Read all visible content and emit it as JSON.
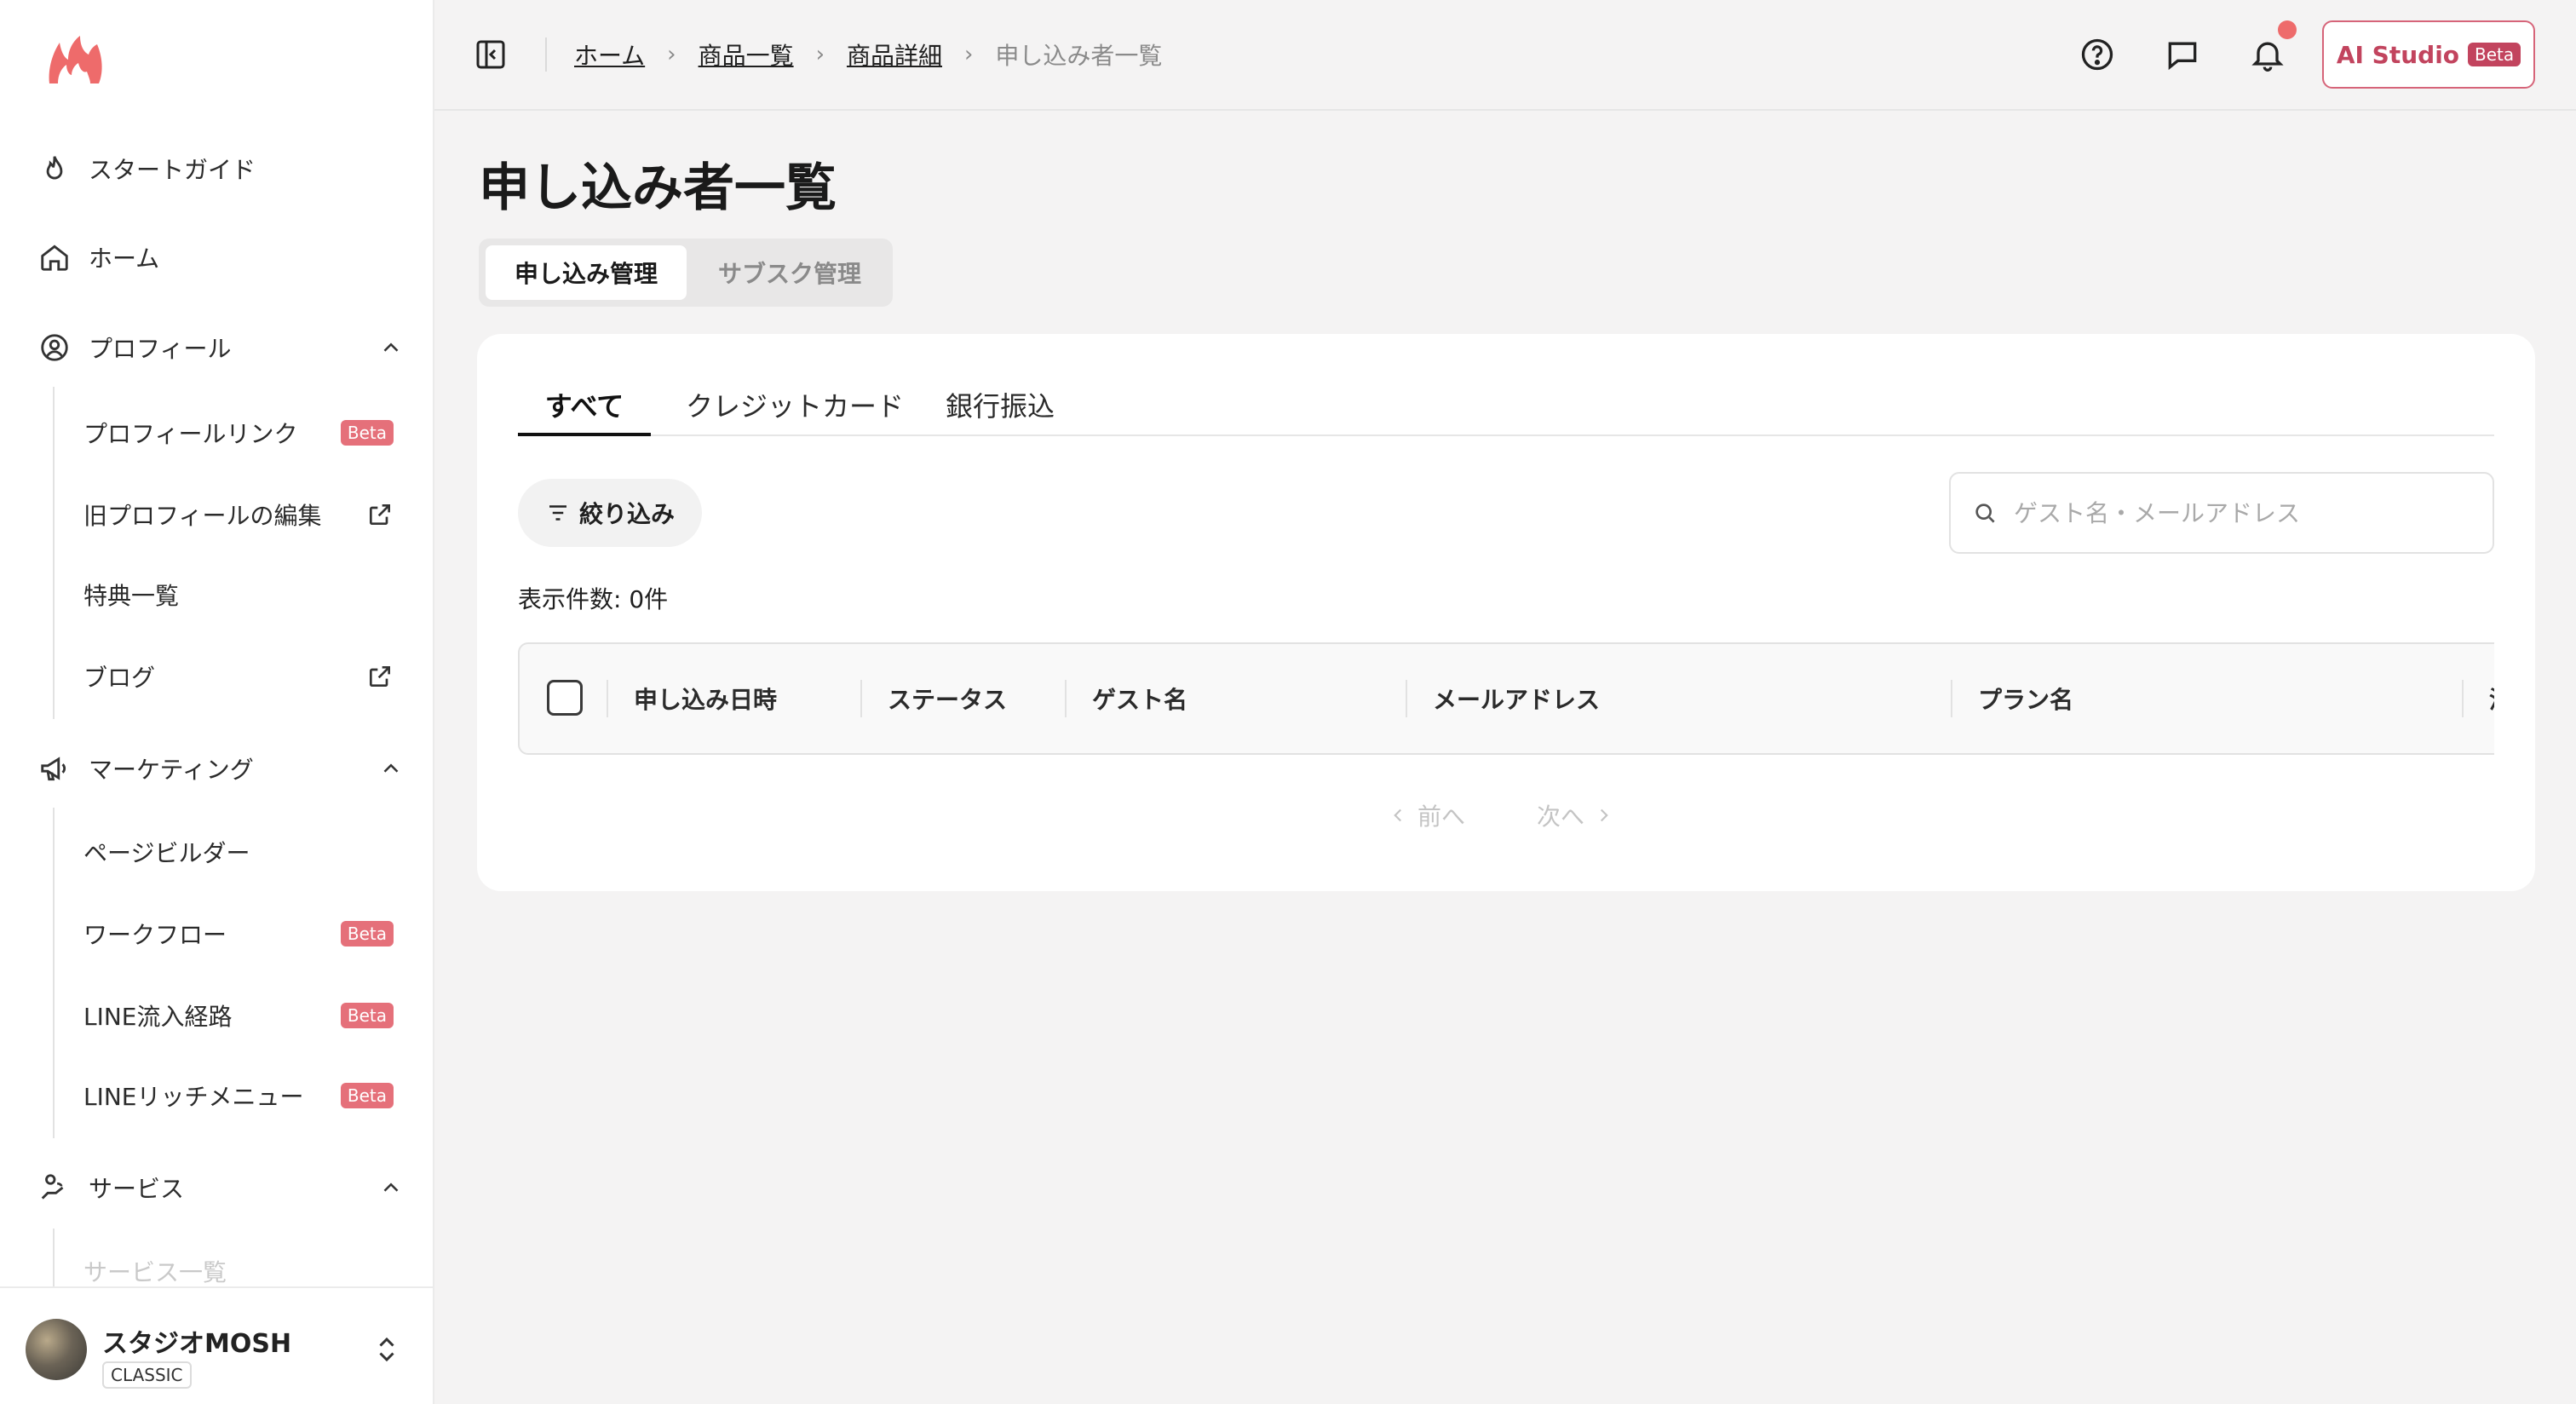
{
  "sidebar": {
    "items": [
      {
        "label": "スタートガイド"
      },
      {
        "label": "ホーム"
      },
      {
        "label": "プロフィール"
      },
      {
        "label": "マーケティング"
      },
      {
        "label": "サービス"
      }
    ],
    "profile_sub": [
      {
        "label": "プロフィールリンク",
        "badge": "Beta"
      },
      {
        "label": "旧プロフィールの編集"
      },
      {
        "label": "特典一覧"
      },
      {
        "label": "ブログ"
      }
    ],
    "marketing_sub": [
      {
        "label": "ページビルダー"
      },
      {
        "label": "ワークフロー",
        "badge": "Beta"
      },
      {
        "label": "LINE流入経路",
        "badge": "Beta"
      },
      {
        "label": "LINEリッチメニュー",
        "badge": "Beta"
      }
    ],
    "service_sub": [
      {
        "label": "サービス一覧"
      }
    ],
    "account": {
      "name": "スタジオMOSH",
      "plan": "CLASSIC"
    }
  },
  "breadcrumb": [
    "ホーム",
    "商品一覧",
    "商品詳細",
    "申し込み者一覧"
  ],
  "header": {
    "ai_label": "AI Studio",
    "ai_badge": "Beta"
  },
  "page": {
    "title": "申し込み者一覧",
    "segments": [
      "申し込み管理",
      "サブスク管理"
    ],
    "tabs": [
      "すべて",
      "クレジットカード",
      "銀行振込"
    ],
    "filter_label": "絞り込み",
    "search_placeholder": "ゲスト名・メールアドレス",
    "count_label": "表示件数: 0件",
    "columns": [
      "申し込み日時",
      "ステータス",
      "ゲスト名",
      "メールアドレス",
      "プラン名",
      "決"
    ],
    "pager": {
      "prev": "前へ",
      "next": "次へ"
    }
  },
  "colors": {
    "brand": "#ee6b6b",
    "accent": "#c2445e",
    "badge": "#e5707a"
  }
}
